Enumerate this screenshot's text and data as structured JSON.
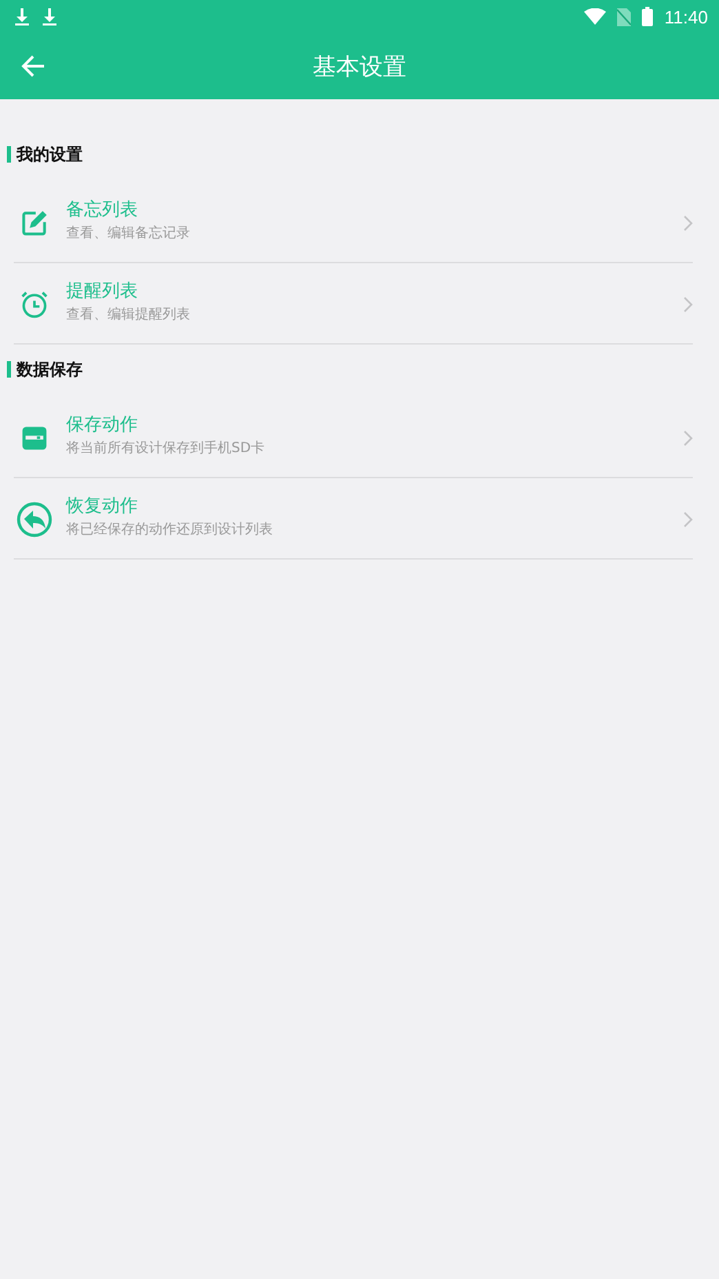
{
  "status_bar": {
    "time": "11:40"
  },
  "toolbar": {
    "title": "基本设置"
  },
  "sections": [
    {
      "title": "我的设置",
      "items": [
        {
          "kind": "edit",
          "title": "备忘列表",
          "subtitle": "查看、编辑备忘记录"
        },
        {
          "kind": "alarm",
          "title": "提醒列表",
          "subtitle": "查看、编辑提醒列表"
        }
      ]
    },
    {
      "title": "数据保存",
      "items": [
        {
          "kind": "save",
          "title": "保存动作",
          "subtitle": "将当前所有设计保存到手机SD卡"
        },
        {
          "kind": "restore",
          "title": "恢复动作",
          "subtitle": "将已经保存的动作还原到设计列表"
        }
      ]
    }
  ]
}
